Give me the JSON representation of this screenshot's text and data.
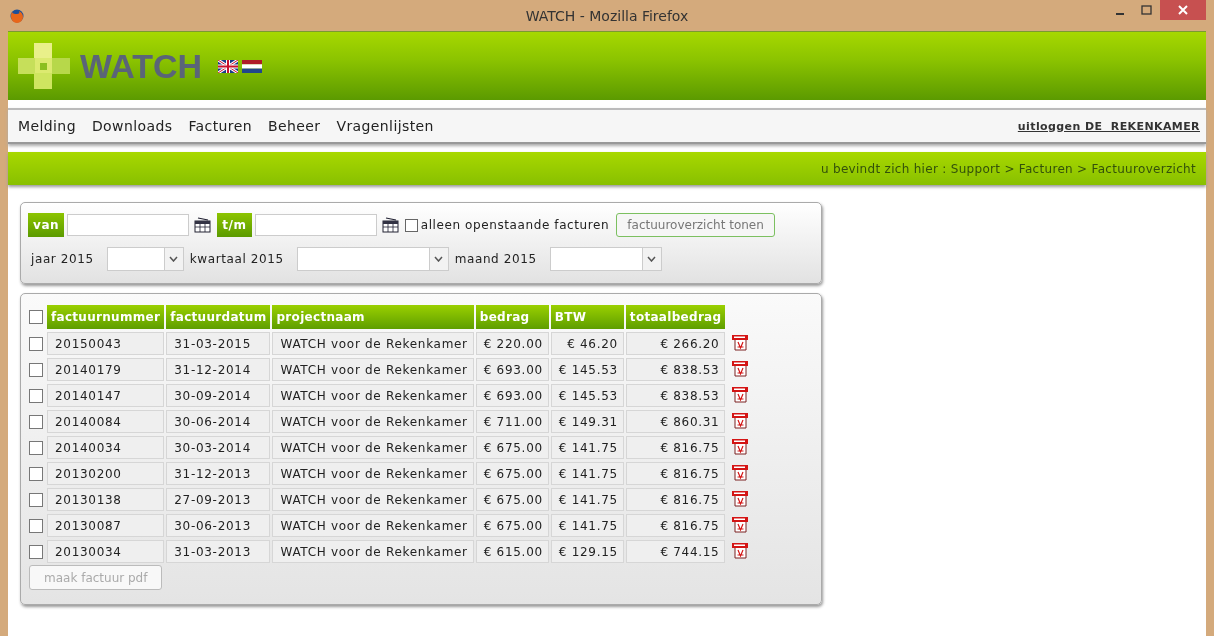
{
  "window": {
    "title": "WATCH - Mozilla Firefox"
  },
  "header": {
    "logo": "WATCH"
  },
  "nav": {
    "items": [
      "Melding",
      "Downloads",
      "Facturen",
      "Beheer",
      "Vragenlijsten"
    ],
    "logout": "uitloggen DE  REKENKAMER"
  },
  "breadcrumb": "u bevindt zich hier : Support > Facturen > Factuuroverzicht",
  "filter": {
    "from_label": "van",
    "to_label": "t/m",
    "open_only": {
      "label": "alleen openstaande facturen",
      "checked": false
    },
    "show_button": "factuuroverzicht tonen",
    "selects": [
      {
        "label": "jaar 2015"
      },
      {
        "label": "kwartaal 2015"
      },
      {
        "label": "maand 2015"
      }
    ]
  },
  "table": {
    "select_all": {
      "checked": false
    },
    "columns": [
      "factuurnummer",
      "factuurdatum",
      "projectnaam",
      "bedrag",
      "BTW",
      "totaalbedrag"
    ],
    "rows": [
      {
        "checked": false,
        "cells": [
          "20150043",
          "31-03-2015",
          "WATCH voor de Rekenkamer",
          "€ 220.00",
          "€ 46.20",
          "€ 266.20"
        ]
      },
      {
        "checked": false,
        "cells": [
          "20140179",
          "31-12-2014",
          "WATCH voor de Rekenkamer",
          "€ 693.00",
          "€ 145.53",
          "€ 838.53"
        ]
      },
      {
        "checked": false,
        "cells": [
          "20140147",
          "30-09-2014",
          "WATCH voor de Rekenkamer",
          "€ 693.00",
          "€ 145.53",
          "€ 838.53"
        ]
      },
      {
        "checked": false,
        "cells": [
          "20140084",
          "30-06-2014",
          "WATCH voor de Rekenkamer",
          "€ 711.00",
          "€ 149.31",
          "€ 860.31"
        ]
      },
      {
        "checked": false,
        "cells": [
          "20140034",
          "30-03-2014",
          "WATCH voor de Rekenkamer",
          "€ 675.00",
          "€ 141.75",
          "€ 816.75"
        ]
      },
      {
        "checked": false,
        "cells": [
          "20130200",
          "31-12-2013",
          "WATCH voor de Rekenkamer",
          "€ 675.00",
          "€ 141.75",
          "€ 816.75"
        ]
      },
      {
        "checked": false,
        "cells": [
          "20130138",
          "27-09-2013",
          "WATCH voor de Rekenkamer",
          "€ 675.00",
          "€ 141.75",
          "€ 816.75"
        ]
      },
      {
        "checked": false,
        "cells": [
          "20130087",
          "30-06-2013",
          "WATCH voor de Rekenkamer",
          "€ 675.00",
          "€ 141.75",
          "€ 816.75"
        ]
      },
      {
        "checked": false,
        "cells": [
          "20130034",
          "31-03-2013",
          "WATCH voor de Rekenkamer",
          "€ 615.00",
          "€ 129.15",
          "€ 744.15"
        ]
      }
    ],
    "pdf_button": {
      "label": "maak factuur pdf",
      "disabled": true
    }
  }
}
